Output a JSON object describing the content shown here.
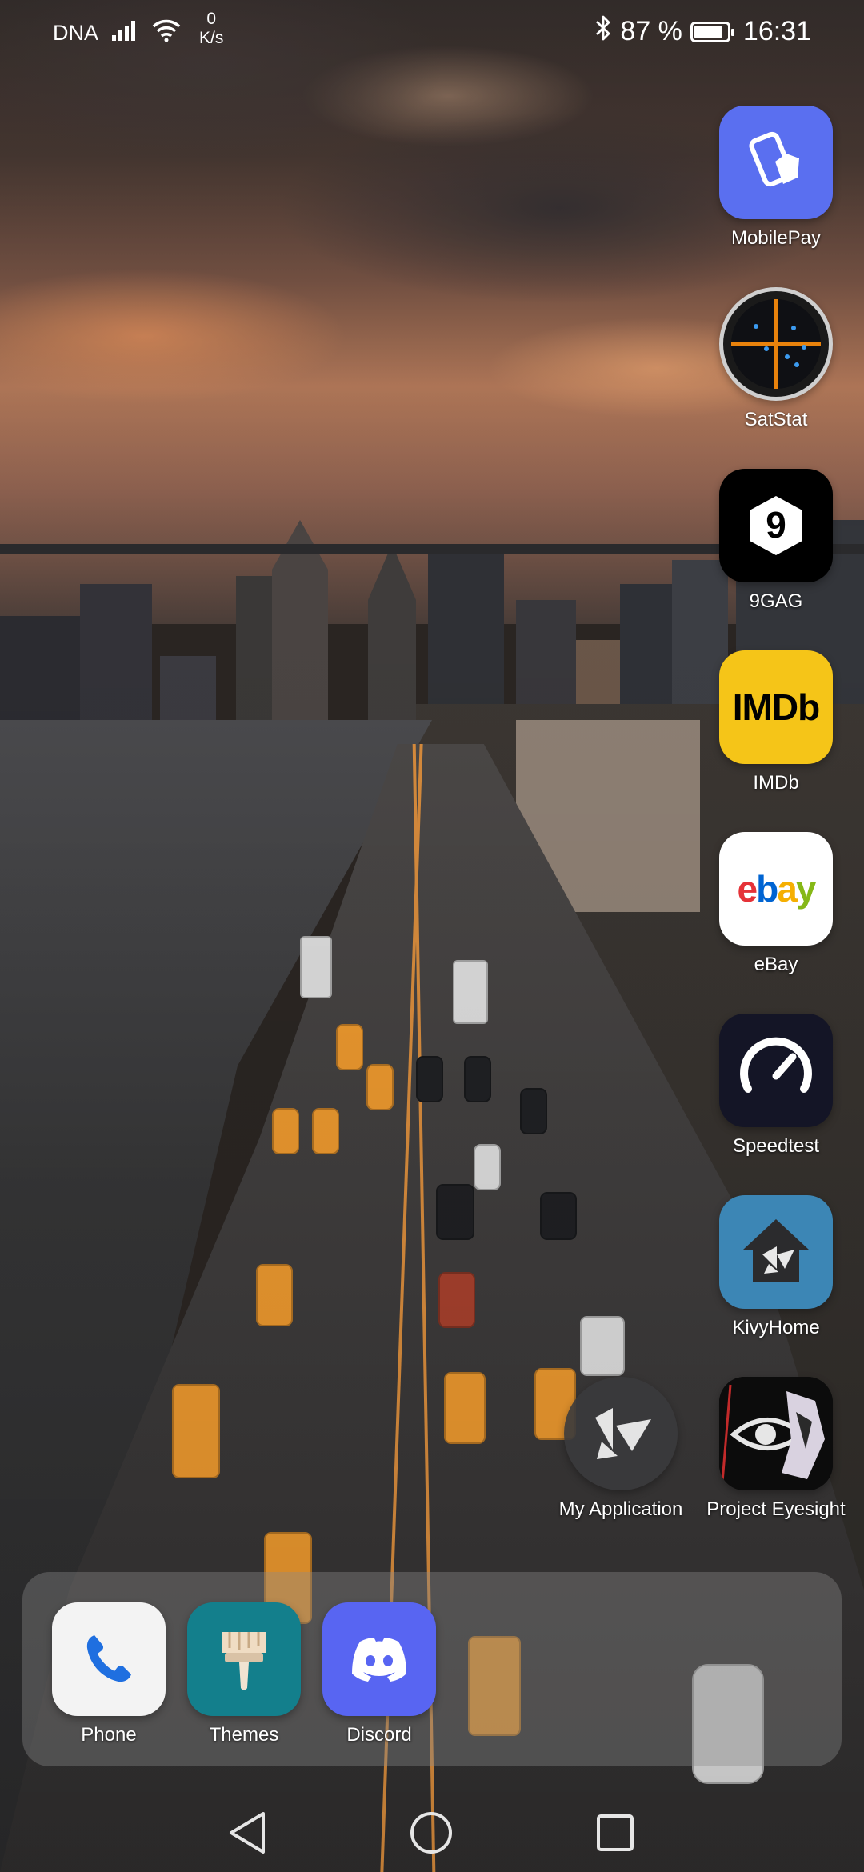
{
  "status_bar": {
    "carrier": "DNA",
    "net_speed_value": "0",
    "net_speed_unit": "K/s",
    "battery_text": "87 %",
    "battery_level": 0.87,
    "time": "16:31"
  },
  "apps": [
    {
      "label": "MobilePay",
      "icon": "mobilepay-icon",
      "color": "#5a6ff0"
    },
    {
      "label": "SatStat",
      "icon": "satstat-icon",
      "color": "#1a1a1a"
    },
    {
      "label": "9GAG",
      "icon": "9gag-icon",
      "color": "#000000",
      "glyph": "9"
    },
    {
      "label": "IMDb",
      "icon": "imdb-icon",
      "color": "#f5c518",
      "glyph": "IMDb"
    },
    {
      "label": "eBay",
      "icon": "ebay-icon",
      "color": "#ffffff",
      "glyph_letters": [
        "e",
        "b",
        "a",
        "y"
      ],
      "letter_colors": [
        "#e53238",
        "#0064d2",
        "#f5af02",
        "#86b817"
      ]
    },
    {
      "label": "Speedtest",
      "icon": "speedtest-icon",
      "color": "#141526"
    },
    {
      "label": "KivyHome",
      "icon": "kivyhome-icon",
      "color": "#3c86b5"
    },
    {
      "label": "My Application",
      "icon": "kivy-icon",
      "color": "#3a3a3c"
    },
    {
      "label": "Project Eyesight",
      "icon": "project-eyesight-icon",
      "color": "#0c0c0c"
    }
  ],
  "dock": [
    {
      "label": "Phone",
      "icon": "phone-icon",
      "color": "#f3f3f3"
    },
    {
      "label": "Themes",
      "icon": "paintbrush-icon",
      "color": "#137f8c"
    },
    {
      "label": "Discord",
      "icon": "discord-icon",
      "color": "#5865f2"
    }
  ],
  "navigation": {
    "back": "back-icon",
    "home": "home-icon",
    "recents": "recents-icon"
  }
}
